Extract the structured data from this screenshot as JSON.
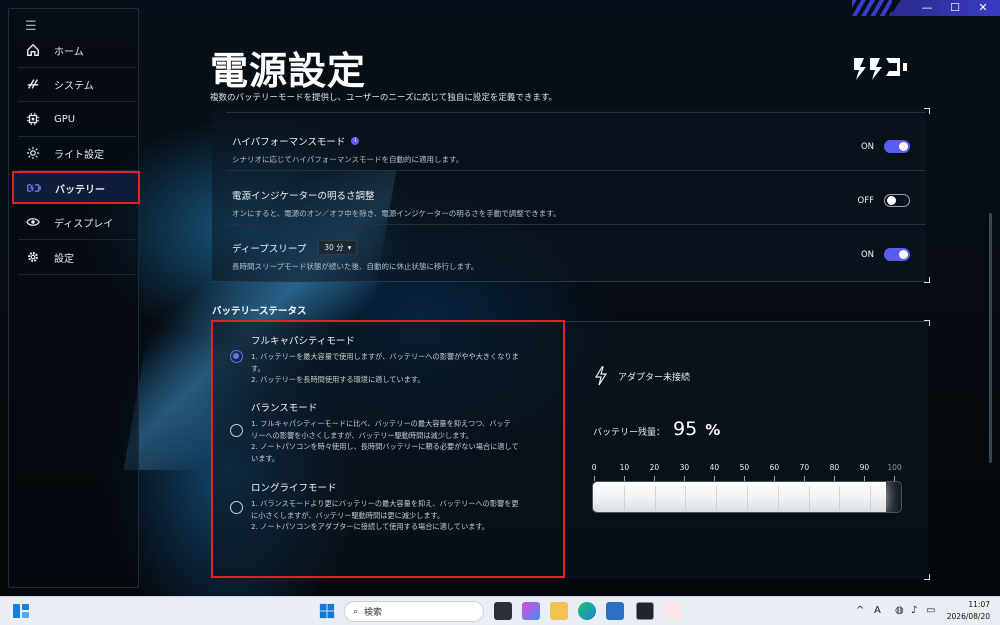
{
  "window_controls": {
    "minimize": "—",
    "maximize": "☐",
    "close": "✕"
  },
  "sidebar": {
    "items": [
      {
        "label": "ホーム",
        "icon": "home-icon"
      },
      {
        "label": "システム",
        "icon": "system-icon"
      },
      {
        "label": "GPU",
        "icon": "gpu-icon"
      },
      {
        "label": "ライト設定",
        "icon": "light-icon"
      },
      {
        "label": "バッテリー",
        "icon": "battery-icon",
        "active": true
      },
      {
        "label": "ディスプレイ",
        "icon": "display-icon"
      },
      {
        "label": "設定",
        "icon": "gear-icon"
      }
    ]
  },
  "header": {
    "title": "電源設定",
    "subtitle": "複数のバッテリーモードを提供し、ユーザーのニーズに応じて独自に設定を定義できます。"
  },
  "settings": {
    "high_performance": {
      "title": "ハイパフォーマンスモード",
      "desc": "シナリオに応じてハイパフォーマンスモードを自動的に適用します。",
      "state": "ON"
    },
    "indicator": {
      "title": "電源インジケーターの明るさ調整",
      "desc": "オンにすると、電源のオン／オフ中を除き、電源インジケーターの明るさを手動で調整できます。",
      "state": "OFF"
    },
    "deep_sleep": {
      "title": "ディープスリープ",
      "select_value": "30 分",
      "desc": "長時間スリープモード状態が続いた後、自動的に休止状態に移行します。",
      "state": "ON"
    }
  },
  "battery_status": {
    "section_title": "バッテリーステータス",
    "modes": [
      {
        "name": "フルキャパシティモード",
        "checked": true,
        "lines": [
          "1. バッテリーを最大容量で使用しますが、バッテリーへの影響がやや大きくなりま",
          "す。",
          "2. バッテリーを長時間使用する環境に適しています。"
        ]
      },
      {
        "name": "バランスモード",
        "checked": false,
        "lines": [
          "1. フルキャパシティーモードに比べ、バッテリーの最大容量を抑えつつ、バッテ",
          "リーへの影響を小さくしますが、バッテリー駆動時間は減少します。",
          "2. ノートパソコンを時々使用し、長時間バッテリーに頼る必要がない場合に適して",
          "います。"
        ]
      },
      {
        "name": "ロングライフモード",
        "checked": false,
        "lines": [
          "1. バランスモードより更にバッテリーの最大容量を抑え、バッテリーへの影響を更",
          "に小さくしますが、バッテリー駆動時間は更に減少します。",
          "2. ノートパソコンをアダプターに接続して使用する場合に適しています。"
        ]
      }
    ],
    "adapter_status": "アダプター未接続",
    "charge_label": "バッテリー残量：",
    "charge_value": "95",
    "charge_unit": "%",
    "charge_fraction": 0.95,
    "scale": [
      "0",
      "10",
      "20",
      "30",
      "40",
      "50",
      "60",
      "70",
      "80",
      "90",
      "100"
    ]
  },
  "taskbar": {
    "search_placeholder": "検索",
    "time": "11:07",
    "date": "2026/08/20",
    "ime": "A"
  },
  "colors": {
    "accent": "#5a5ef0",
    "highlight_box": "#e0222a",
    "background": "#05080c"
  }
}
